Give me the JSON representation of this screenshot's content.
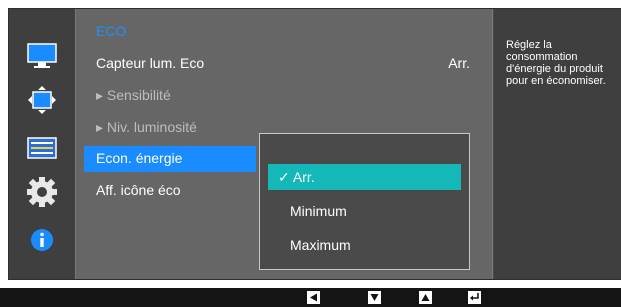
{
  "menu": {
    "title": "ECO",
    "items": [
      {
        "label": "Capteur lum. Eco",
        "value": "Arr."
      },
      {
        "label": "▸ Sensibilité"
      },
      {
        "label": "▸ Niv. luminosité"
      },
      {
        "label": "Econ. énergie"
      },
      {
        "label": "Aff. icône éco"
      }
    ]
  },
  "dropdown": {
    "options": [
      "✓ Arr.",
      "Minimum",
      "Maximum"
    ],
    "selected": "Arr."
  },
  "help": {
    "text": "Réglez la consommation d'énergie du produit pour en économiser."
  },
  "side_icons": [
    "monitor-icon",
    "resize-icon",
    "settings-panel-icon",
    "gear-icon",
    "info-icon"
  ],
  "bottom_keys": [
    "left-arrow-key-icon",
    "down-arrow-key-icon",
    "up-arrow-key-icon",
    "enter-key-icon"
  ],
  "colors": {
    "accent": "#1a8cff",
    "selection": "#14b8b8",
    "eco_title": "#1e90ff"
  }
}
